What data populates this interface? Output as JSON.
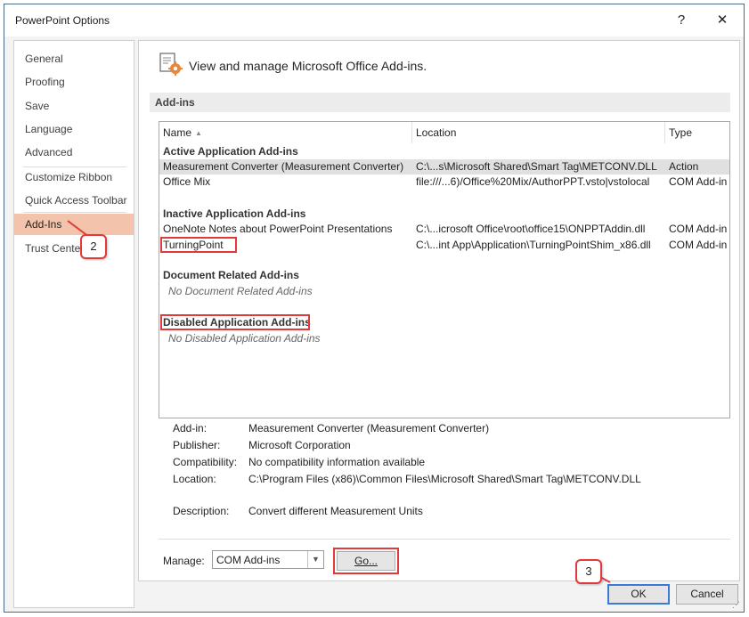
{
  "window": {
    "title": "PowerPoint Options",
    "help": "?",
    "close": "✕"
  },
  "nav": {
    "items": [
      {
        "label": "General"
      },
      {
        "label": "Proofing"
      },
      {
        "label": "Save"
      },
      {
        "label": "Language"
      },
      {
        "label": "Advanced"
      },
      {
        "label": "Customize Ribbon"
      },
      {
        "label": "Quick Access Toolbar"
      },
      {
        "label": "Add-Ins"
      },
      {
        "label": "Trust Center"
      }
    ],
    "selected": "Add-Ins",
    "accent_color": "#f3c3ab"
  },
  "header": {
    "text": "View and manage Microsoft Office Add-ins.",
    "icon": "addins-gear-icon"
  },
  "section": {
    "title": "Add-ins"
  },
  "list": {
    "columns": {
      "name": "Name",
      "location": "Location",
      "type": "Type"
    },
    "groups": {
      "active": {
        "title": "Active Application Add-ins",
        "rows": [
          {
            "name": "Measurement Converter (Measurement Converter)",
            "location": "C:\\...s\\Microsoft Shared\\Smart Tag\\METCONV.DLL",
            "type": "Action"
          },
          {
            "name": "Office Mix",
            "location": "file:///...6)/Office%20Mix/AuthorPPT.vsto|vstolocal",
            "type": "COM Add-in"
          }
        ]
      },
      "inactive": {
        "title": "Inactive Application Add-ins",
        "rows": [
          {
            "name": "OneNote Notes about PowerPoint Presentations",
            "location": "C:\\...icrosoft Office\\root\\office15\\ONPPTAddin.dll",
            "type": "COM Add-in"
          },
          {
            "name": "TurningPoint",
            "location": "C:\\...int App\\Application\\TurningPointShim_x86.dll",
            "type": "COM Add-in"
          }
        ]
      },
      "document": {
        "title": "Document Related Add-ins",
        "empty": "No Document Related Add-ins"
      },
      "disabled": {
        "title": "Disabled Application Add-ins",
        "empty": "No Disabled Application Add-ins"
      }
    }
  },
  "details": {
    "addin_label": "Add-in:",
    "addin_value": "Measurement Converter (Measurement Converter)",
    "publisher_label": "Publisher:",
    "publisher_value": "Microsoft Corporation",
    "compat_label": "Compatibility:",
    "compat_value": "No compatibility information available",
    "location_label": "Location:",
    "location_value": "C:\\Program Files (x86)\\Common Files\\Microsoft Shared\\Smart Tag\\METCONV.DLL",
    "description_label": "Description:",
    "description_value": "Convert different Measurement Units"
  },
  "manage": {
    "label": "Manage:",
    "selected": "COM Add-ins",
    "go": "Go..."
  },
  "buttons": {
    "ok": "OK",
    "cancel": "Cancel"
  },
  "callouts": {
    "two": "2",
    "three": "3"
  },
  "annotation_color": "#e23a3a"
}
